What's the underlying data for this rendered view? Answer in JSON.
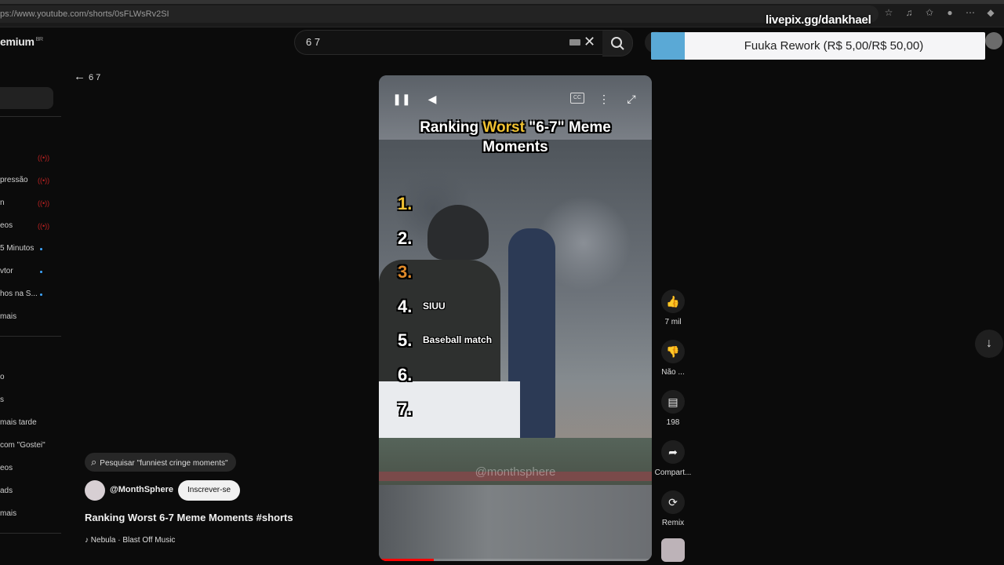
{
  "browser": {
    "url": "ps://www.youtube.com/shorts/0sFLWsRv2SI",
    "overlay_text": "livepix.gg/dankhael"
  },
  "header": {
    "logo": "emium",
    "logo_region": "BR",
    "search_value": "6 7"
  },
  "donation": {
    "text": "Fuuka Rework (R$ 5,00/R$ 50,00)",
    "progress_fraction": 0.1,
    "fill_color": "#5aa9d6"
  },
  "back": {
    "label": "6 7"
  },
  "sidebar": {
    "items": [
      {
        "label": "pressão",
        "live": true
      },
      {
        "label": "n",
        "live": true
      },
      {
        "label": "eos",
        "live": true
      },
      {
        "label": "5 Minutos",
        "dot": true
      },
      {
        "label": "vtor",
        "dot": true
      },
      {
        "label": "hos na S...",
        "dot": true
      },
      {
        "label": "mais"
      },
      {
        "label": "o"
      },
      {
        "label": "s"
      },
      {
        "label": "mais tarde"
      },
      {
        "label": "com \"Gostei\""
      },
      {
        "label": "eos"
      },
      {
        "label": "ads"
      },
      {
        "label": "mais"
      }
    ]
  },
  "short": {
    "title_line1_pre": "Ranking ",
    "title_line1_hl": "Worst",
    "title_line1_post": " \"6-7\" Meme",
    "title_line2": "Moments",
    "ranks": [
      {
        "num": "1.",
        "text": "",
        "style": "gold"
      },
      {
        "num": "2.",
        "text": "",
        "style": "white"
      },
      {
        "num": "3.",
        "text": "",
        "style": "bronze"
      },
      {
        "num": "4.",
        "text": "SIUU",
        "style": "white"
      },
      {
        "num": "5.",
        "text": "Baseball match",
        "style": "white"
      },
      {
        "num": "6.",
        "text": "",
        "style": "white"
      },
      {
        "num": "7.",
        "text": "",
        "style": "white"
      }
    ],
    "watermark": "@monthsphere",
    "playback_fraction": 0.2,
    "cc_label": "CC"
  },
  "actions": {
    "like_count": "7 mil",
    "dislike_label": "Não ...",
    "comment_count": "198",
    "share_label": "Compart...",
    "remix_label": "Remix"
  },
  "info": {
    "search_suggestion": "Pesquisar \"funniest cringe moments\"",
    "channel": "@MonthSphere",
    "subscribe_label": "Inscrever-se",
    "video_title": "Ranking Worst 6-7 Meme Moments #shorts",
    "music": "Nebula · Blast Off Music"
  },
  "icons": [
    "pause-icon",
    "volume-icon",
    "captions-icon",
    "more-icon",
    "fullscreen-icon",
    "like-icon",
    "dislike-icon",
    "comment-icon",
    "share-icon",
    "remix-icon",
    "search-icon",
    "clear-icon",
    "back-arrow-icon",
    "down-arrow-icon"
  ]
}
